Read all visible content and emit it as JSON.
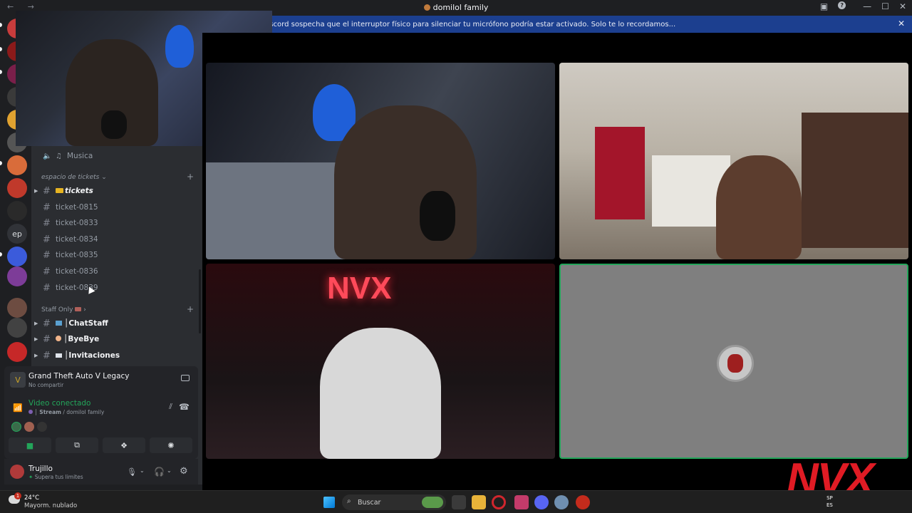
{
  "window": {
    "title": "domilol family",
    "nav_arrows": "← →"
  },
  "banner": {
    "text": "Discord sospecha que el interruptor físico para silenciar tu micrófono podría estar activado. Solo te lo recordamos...",
    "close": "✕"
  },
  "guilds": [
    {
      "label": "ep"
    }
  ],
  "channels": {
    "music": "Musica",
    "category1": "espacio de tickets",
    "tickets_label": "tickets",
    "tickets": [
      "ticket-0815",
      "ticket-0833",
      "ticket-0834",
      "ticket-0835",
      "ticket-0836",
      "ticket-0839"
    ],
    "category2": "Staff Only",
    "staff": [
      "ChatStaff",
      "ByeBye",
      "Invitaciones"
    ]
  },
  "voice": {
    "game_title": "Grand Theft Auto V Legacy",
    "game_status": "No compartir",
    "connected": "Video conectado",
    "channel": "Stream",
    "server": "domilol family"
  },
  "user": {
    "name": "Trujillo",
    "status": "Supera tus limites"
  },
  "taskbar": {
    "weather_temp": "24°C",
    "weather_desc": "Mayorm. nublado",
    "weather_badge": "1",
    "search_placeholder": "Buscar",
    "lang": "SP",
    "lang2": "ES"
  },
  "stream_overlay": {
    "logo_text": "NVX"
  },
  "colors": {
    "discord_bg": "#1e1f22",
    "sidebar_bg": "#2b2d31",
    "banner_bg": "#1c3f8f",
    "connected_green": "#23a55a",
    "brand_red": "#e01b24"
  }
}
